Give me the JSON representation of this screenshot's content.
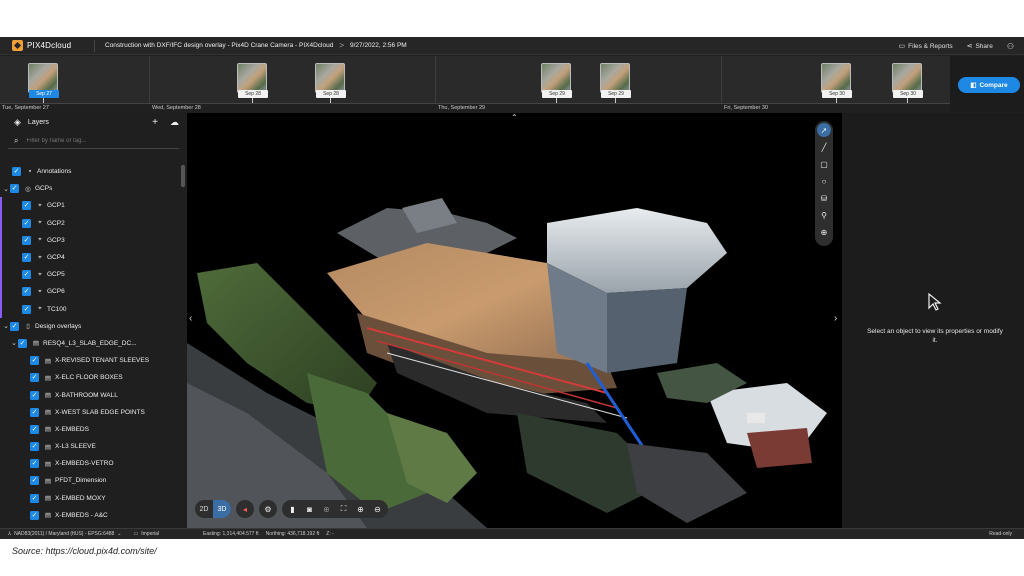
{
  "app": {
    "brand": "PIX4Dcloud",
    "project_title": "Construction with DXF/IFC design overlay - Pix4D Crane Camera - PIX4Dcloud",
    "breadcrumb_sep": ">",
    "datetime": "9/27/2022, 2:56 PM",
    "files_reports": "Files & Reports",
    "share": "Share"
  },
  "timeline": {
    "dates": [
      "Tue, September 27",
      "Wed, September 28",
      "Thu, September 29",
      "Fri, September 30"
    ],
    "thumbs": [
      "Sep 27",
      "Sep 28",
      "Sep 28",
      "Sep 29",
      "Sep 29",
      "Sep 30",
      "Sep 30"
    ],
    "compare_label": "Compare"
  },
  "sidebar": {
    "title": "Layers",
    "search_placeholder": "Filter by name or tag...",
    "items": [
      {
        "label": "Annotations"
      },
      {
        "label": "GCPs"
      },
      {
        "label": "GCP1"
      },
      {
        "label": "GCP2"
      },
      {
        "label": "GCP3"
      },
      {
        "label": "GCP4"
      },
      {
        "label": "GCP5"
      },
      {
        "label": "GCP6"
      },
      {
        "label": "TC100"
      },
      {
        "label": "Design overlays"
      },
      {
        "label": "RESQ4_L3_SLAB_EDGE_DC..."
      },
      {
        "label": "X-REVISED TENANT SLEEVES"
      },
      {
        "label": "X-ELC FLOOR BOXES"
      },
      {
        "label": "X-BATHROOM WALL"
      },
      {
        "label": "X-WEST SLAB EDGE POINTS"
      },
      {
        "label": "X-EMBEDS"
      },
      {
        "label": "X-L3 SLEEVE"
      },
      {
        "label": "X-EMBEDS-VETRO"
      },
      {
        "label": "PFDT_Dimension"
      },
      {
        "label": "X-EMBED MOXY"
      },
      {
        "label": "X-EMBEDS - A&C"
      }
    ]
  },
  "viewer": {
    "mode_2d": "2D",
    "mode_3d": "3D"
  },
  "right_panel": {
    "hint": "Select an object to view its properties or modify it."
  },
  "status": {
    "crs": "NAD83(2011) / Maryland (ftUS) - EPSG:6488",
    "units": "Imperial",
    "easting": "Easting: 1,314,404.577 ft",
    "northing": "Northing: 436,718.192 ft",
    "z": "Z: -",
    "access": "Read-only"
  },
  "caption": "Source: https://cloud.pix4d.com/site/",
  "colors": {
    "accent": "#1e88e5",
    "gcp_bar": "#8a5cf6",
    "background": "#1f1f1f"
  }
}
